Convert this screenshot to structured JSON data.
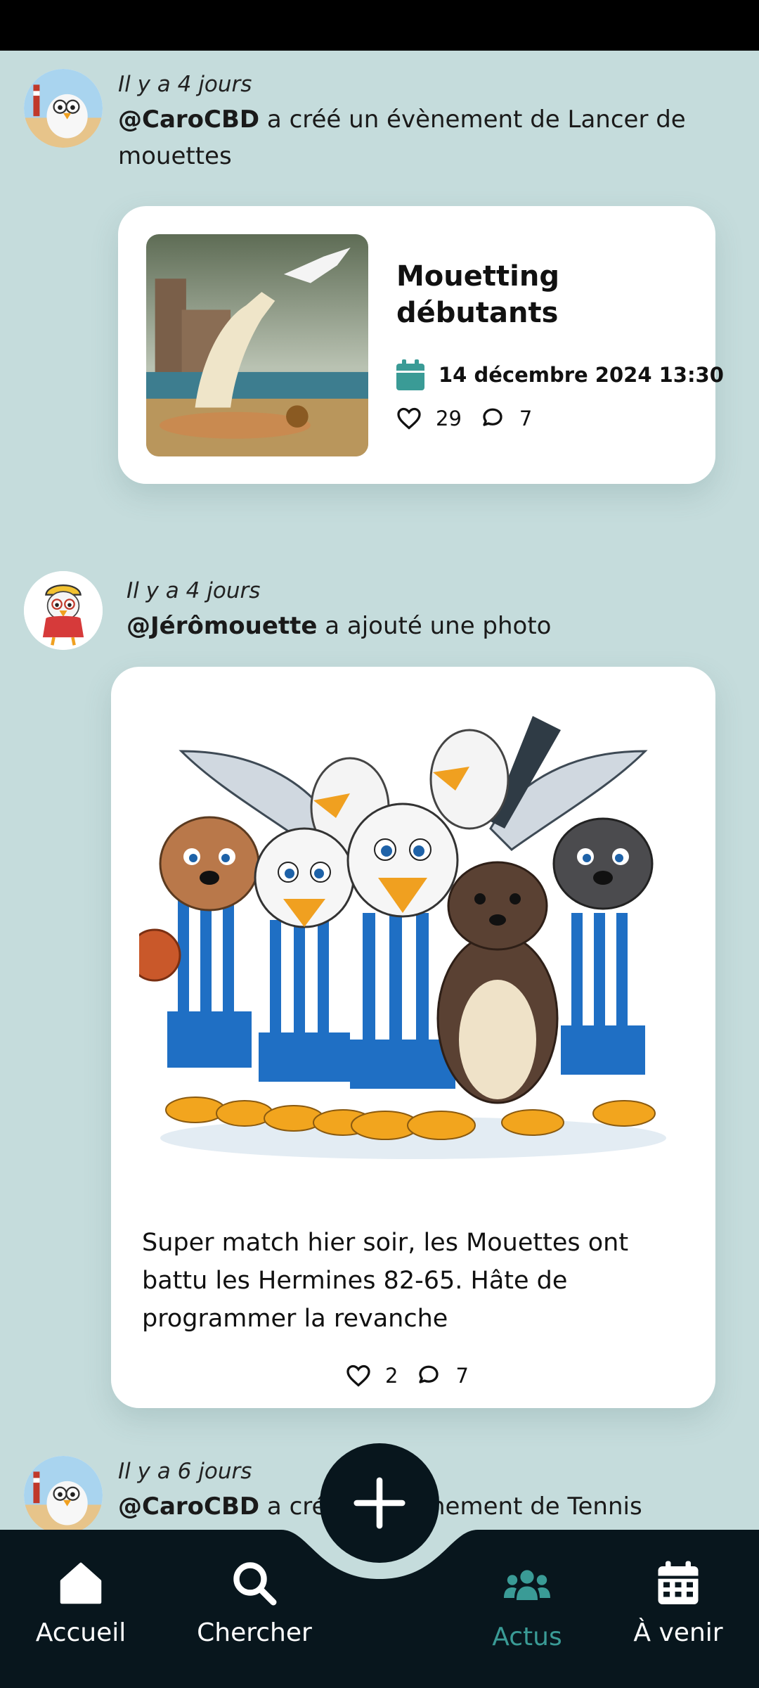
{
  "feed": {
    "post1": {
      "time": "Il y a 4 jours",
      "user": "@CaroCBD",
      "action": " a créé un évènement de Lancer de mouettes",
      "event": {
        "title": "Mouetting débutants",
        "date": "14 décembre 2024 13:30",
        "likes": "29",
        "comments": "7"
      }
    },
    "post2": {
      "time": "Il y a 4 jours",
      "user": "@Jérômouette",
      "action": " a ajouté une photo",
      "text": "Super match hier soir, les Mouettes ont battu les Hermines 82-65. Hâte de programmer la revanche",
      "likes": "2",
      "comments": "7"
    },
    "post3": {
      "time": "Il y a 6 jours",
      "user": "@CaroCBD",
      "action": " a créé un évènement de Tennis"
    }
  },
  "nav": {
    "items": [
      {
        "label": "Accueil",
        "icon": "home-icon"
      },
      {
        "label": "Chercher",
        "icon": "search-icon"
      },
      {
        "label": "Actus",
        "icon": "people-icon",
        "active": true
      },
      {
        "label": "À venir",
        "icon": "calendar-icon"
      }
    ],
    "fab_icon": "plus-icon"
  },
  "colors": {
    "background": "#c5dcdc",
    "accent": "#3a9b96",
    "nav_background": "#08161d",
    "card": "#ffffff"
  }
}
